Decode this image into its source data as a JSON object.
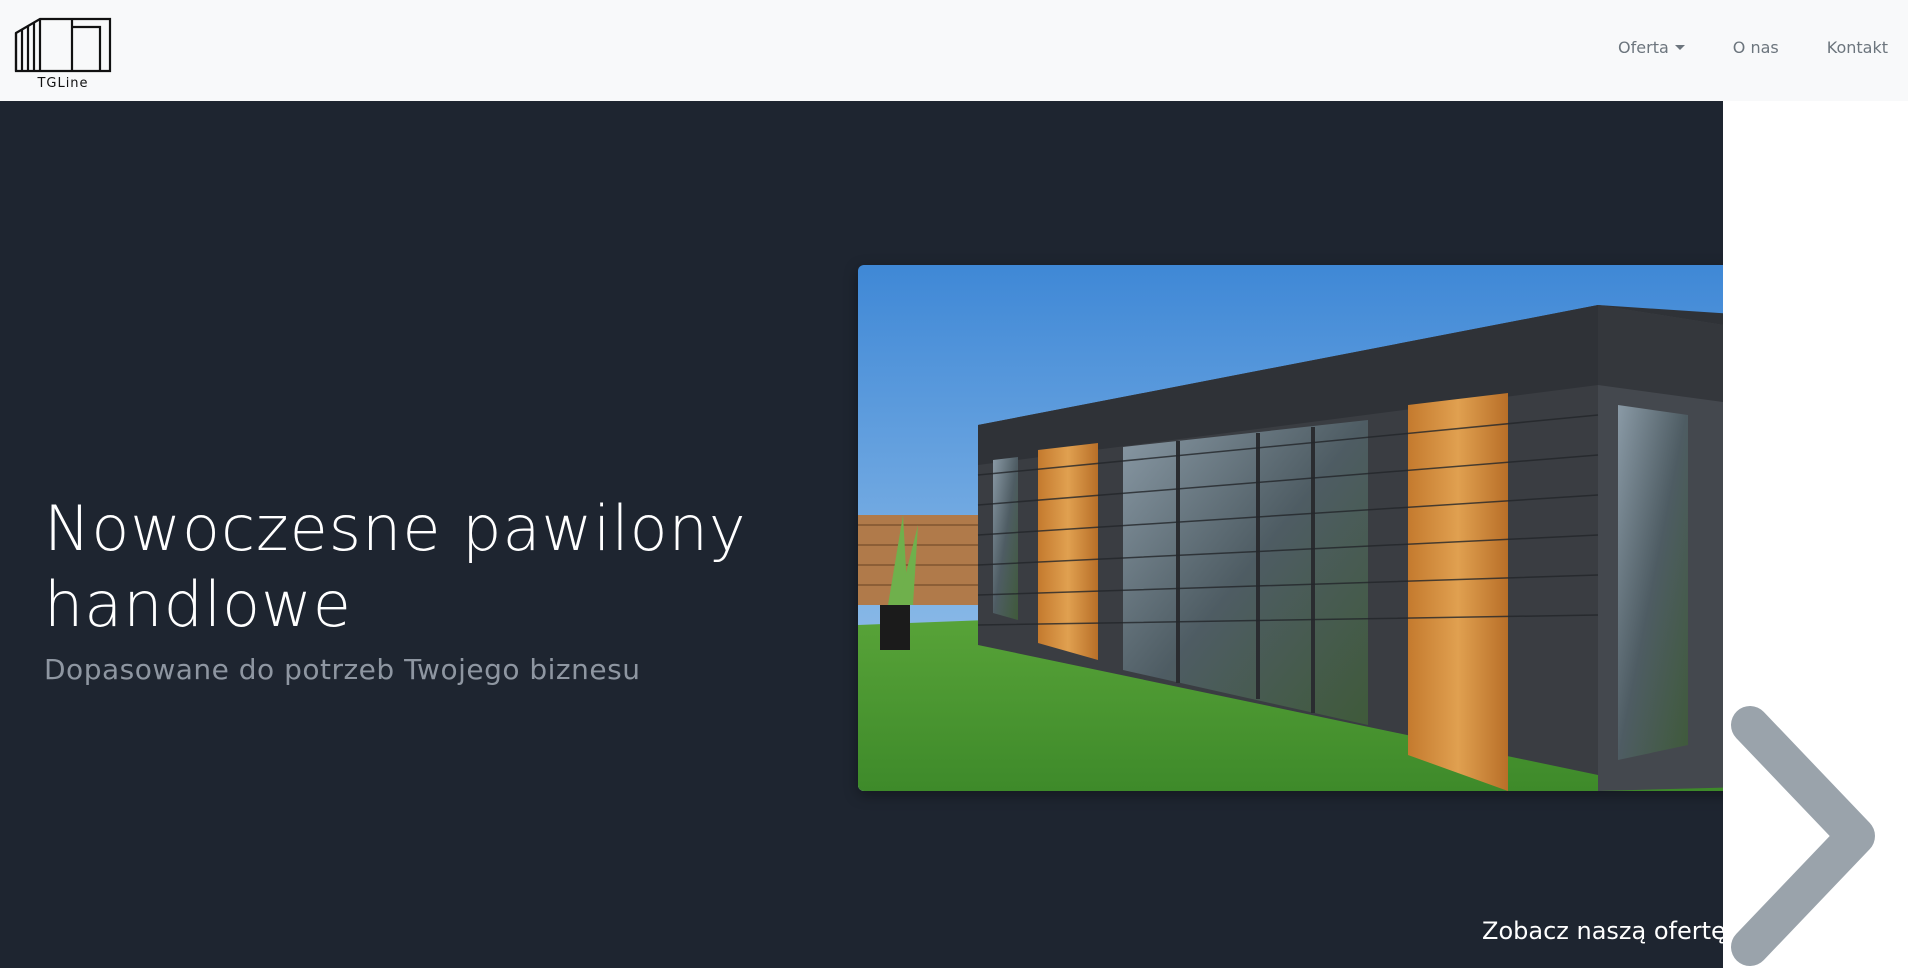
{
  "brand": {
    "name": "TGLine",
    "logo_icon": "container-icon"
  },
  "nav": {
    "items": [
      {
        "label": "Oferta",
        "has_dropdown": true
      },
      {
        "label": "O nas"
      },
      {
        "label": "Kontakt"
      }
    ]
  },
  "hero": {
    "title": "Nowoczesne pawilony handlowe",
    "subtitle": "Dopasowane do potrzeb Twojego biznesu",
    "image_subject": "modular-pavilion-photo",
    "cta_label": "Zobacz naszą ofertę",
    "cta_icon": "chevron-right-icon"
  },
  "colors": {
    "hero_bg": "#1e2530",
    "navbar_bg": "#f8f9fa",
    "nav_text": "#6c757d",
    "chevron": "#9aa3ab"
  }
}
